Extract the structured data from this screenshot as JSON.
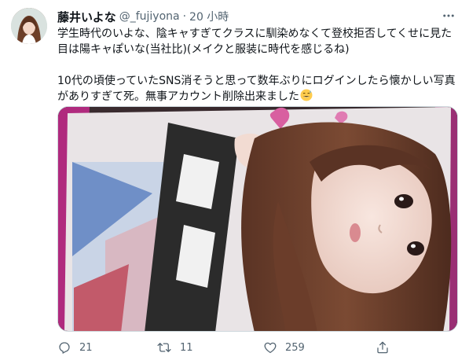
{
  "tweet": {
    "author_name": "藤井いよな",
    "handle": "@_fujiyona",
    "separator": "·",
    "time": "20 小時",
    "more_label": "···",
    "text_lines": [
      "学生時代のいよな、陰キャすぎてクラスに馴染めなくて登校拒否してくせに見た",
      "目は陽キャぽいな(当社比)(メイクと服装に時代を感じるね)",
      "10代の頃使っていたSNS消そうと思って数年ぶりにログインしたら懐かしい写真",
      "がありすぎて死。無事アカウント削除出来ました"
    ],
    "emoji": "grinning-sweat-emoji"
  },
  "actions": {
    "reply_count": "21",
    "retweet_count": "11",
    "like_count": "259"
  },
  "icons": {
    "reply": "reply-icon",
    "retweet": "retweet-icon",
    "like": "heart-icon",
    "share": "share-icon",
    "more": "more-icon"
  },
  "colors": {
    "text_primary": "#0f1419",
    "text_secondary": "#536471",
    "border": "#cfd9de"
  }
}
